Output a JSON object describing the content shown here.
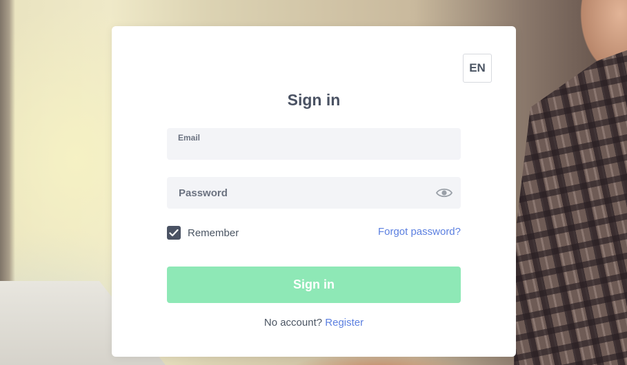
{
  "language": {
    "label": "EN"
  },
  "form": {
    "title": "Sign in",
    "email": {
      "label": "Email",
      "value": ""
    },
    "password": {
      "placeholder": "Password",
      "value": "",
      "toggle_icon": "eye-icon"
    },
    "remember": {
      "label": "Remember",
      "checked": true
    },
    "forgot_link": "Forgot password?",
    "submit_label": "Sign in",
    "no_account_text": "No account?",
    "register_link": "Register"
  },
  "colors": {
    "accent_button": "#8ee8b6",
    "link": "#5b7fe0",
    "checkbox": "#4a5263",
    "field_bg": "#f3f4f7"
  }
}
